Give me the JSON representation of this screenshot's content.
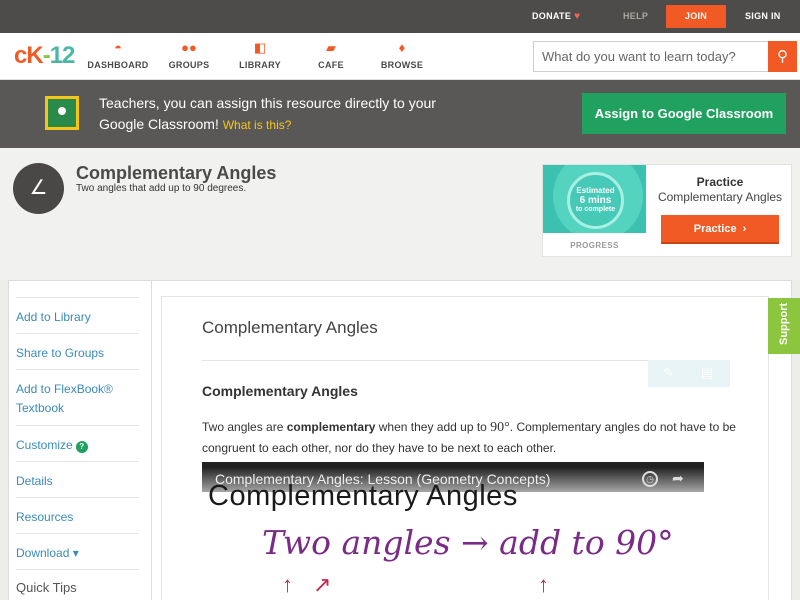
{
  "topbar": {
    "donate": "DONATE",
    "help": "HELP",
    "join": "JOIN",
    "signin": "SIGN IN"
  },
  "logo": {
    "ck": "cK",
    "dash": "-",
    "num": "12"
  },
  "nav": {
    "items": [
      {
        "label": "DASHBOARD",
        "icon": "dashboard-icon"
      },
      {
        "label": "GROUPS",
        "icon": "groups-icon"
      },
      {
        "label": "LIBRARY",
        "icon": "library-icon"
      },
      {
        "label": "CAFE",
        "icon": "cafe-icon"
      },
      {
        "label": "BROWSE",
        "icon": "browse-icon"
      }
    ]
  },
  "search": {
    "placeholder": "What do you want to learn today?"
  },
  "classroom": {
    "text": "Teachers, you can assign this resource directly to your Google Classroom!",
    "what": "What is this?",
    "button": "Assign to Google Classroom"
  },
  "hero": {
    "title": "Complementary Angles",
    "subtitle": "Two angles that add up to 90 degrees."
  },
  "practice": {
    "ring_line1": "Estimated",
    "ring_line2": "6 mins",
    "ring_line3": "to complete",
    "progress": "PROGRESS",
    "title": "Practice",
    "subtitle": "Complementary Angles",
    "button": "Practice"
  },
  "sidebar": {
    "items": [
      "Add to Library",
      "Share to Groups",
      "Add to FlexBook® Textbook",
      "Customize",
      "Details",
      "Resources",
      "Download ▾"
    ],
    "quick_tips": "Quick Tips"
  },
  "content": {
    "doc_title": "Complementary Angles",
    "section_title": "Complementary Angles",
    "para_before": "Two angles are ",
    "para_bold": "complementary",
    "para_mid": " when they add up to ",
    "para_math": "90°",
    "para_after": ". Complementary angles do not have to be congruent to each other, nor do they have to be next to each other."
  },
  "video": {
    "title": "Complementary Angles: Lesson (Geometry Concepts)",
    "big_text": "Complementary Angles",
    "handwriting": "Two angles → add to 90°"
  },
  "support": {
    "label": "Support"
  },
  "colors": {
    "brand_orange": "#f15a24",
    "brand_green": "#21a160",
    "link_blue": "#3a8bb7",
    "support_green": "#8cc63f"
  }
}
